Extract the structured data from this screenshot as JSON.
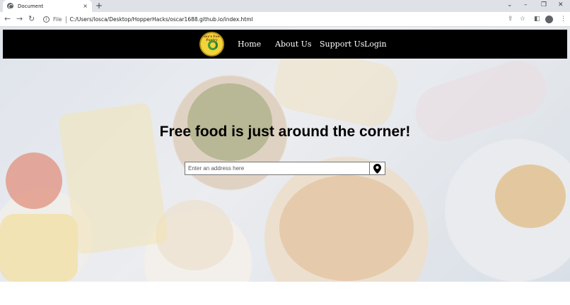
{
  "browser": {
    "tab_title": "Document",
    "tab_close": "×",
    "new_tab": "+",
    "scheme_label": "File",
    "url": "C:/Users/losca/Desktop/HopperHacks/oscar1688.github.io/index.html",
    "icons": [
      "back-icon",
      "forward-icon",
      "reload-icon",
      "info-icon",
      "share-icon",
      "star-icon",
      "sidebar-icon",
      "profile-icon",
      "menu-icon"
    ]
  },
  "window_controls": {
    "collapse": "⌄",
    "minimize": "–",
    "restore": "❐",
    "close": "✕"
  },
  "site": {
    "logo_text": "Alex's Food Pantry",
    "nav": [
      "Home",
      "About Us",
      "Support Us",
      "Login"
    ],
    "headline": "Free food is just around the corner!",
    "search_placeholder": "Enter an address here"
  },
  "colors": {
    "navbar": "#000000",
    "logo": "#f2d33a",
    "headline": "#000000"
  }
}
